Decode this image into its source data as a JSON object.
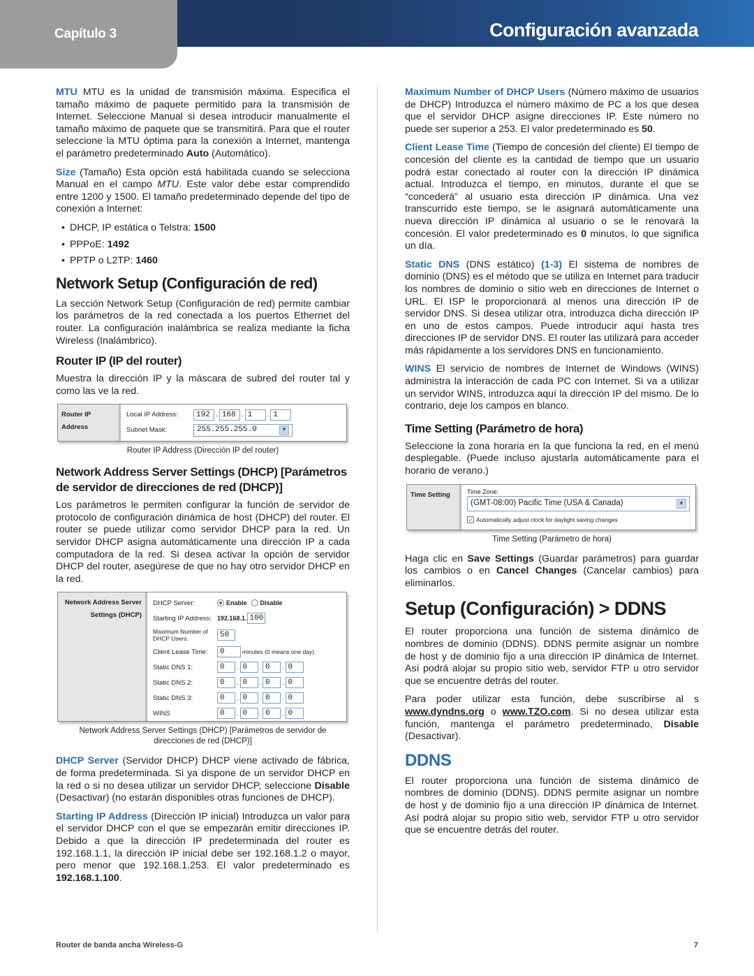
{
  "header": {
    "chapter": "Capítulo 3",
    "title": "Configuración avanzada"
  },
  "left": {
    "mtu": {
      "term": "MTU",
      "text": " MTU es la unidad de transmisión máxima. Especifica el tamaño máximo de paquete permitido para la transmisión de Internet. Seleccione Manual si desea introducir manualmente el tamaño máximo de paquete que se transmitirá. Para que el router seleccione la MTU óptima para la conexión a Internet, mantenga el parámetro predeterminado ",
      "bold": "Auto",
      "tail": " (Automático)."
    },
    "size": {
      "term": "Size",
      "text_a": " (Tamaño) Esta opción está habilitada cuando se selecciona Manual en el campo ",
      "italic": "MTU",
      "text_b": ". Este valor debe estar comprendido entre 1200 y 1500. El tamaño predeterminado depende del tipo de conexión a Internet:"
    },
    "bullets": [
      {
        "label": "DHCP, IP estática o Telstra: ",
        "value": "1500"
      },
      {
        "label": "PPPoE: ",
        "value": "1492"
      },
      {
        "label": "PPTP o L2TP: ",
        "value": "1460"
      }
    ],
    "network_setup": {
      "heading": "Network Setup (Configuración de red)",
      "text": "La sección Network Setup (Configuración de red) permite cambiar los parámetros de la red conectada a los puertos Ethernet del router. La configuración inalámbrica se realiza mediante la ficha Wireless (Inalámbrico)."
    },
    "router_ip": {
      "heading": "Router IP (IP del router)",
      "text": "Muestra la dirección IP y la máscara de subred del router tal y como las ve la red.",
      "figure": {
        "side_label": "Router IP Address",
        "local_ip_label": "Local IP Address:",
        "ip": [
          "192",
          "168",
          "1",
          "1"
        ],
        "subnet_label": "Subnet Mask:",
        "subnet_value": "255.255.255.0"
      },
      "caption": "Router IP Address (Dirección IP del router)"
    },
    "dhcp_section": {
      "heading": "Network Address Server Settings (DHCP) [Parámetros de servidor de direcciones de red (DHCP)]",
      "text": "Los parámetros le permiten configurar la función de servidor de protocolo de configuración dinámica de host (DHCP) del router. El router se puede utilizar como servidor DHCP para la red. Un servidor DHCP asigna automáticamente una dirección IP a cada computadora de la red. Si desea activar la opción de servidor DHCP del router, asegúrese de que no hay otro servidor DHCP en la red.",
      "figure": {
        "side_label": "Network Address Server Settings (DHCP)",
        "dhcp_server_label": "DHCP Server:",
        "enable": "Enable",
        "disable": "Disable",
        "starting_ip_label": "Starting IP Address:",
        "starting_ip_prefix": "192.168.1.",
        "starting_ip_value": "100",
        "max_users_label": "Maximum Number of DHCP Users:",
        "max_users_value": "50",
        "lease_label": "Client Lease Time:",
        "lease_value": "0",
        "lease_unit": "minutes (0 means one day)",
        "dns1_label": "Static DNS 1:",
        "dns2_label": "Static DNS 2:",
        "dns3_label": "Static DNS 3:",
        "wins_label": "WINS",
        "octet": "0"
      },
      "caption": "Network Address Server Settings (DHCP) [Parámetros de servidor de direcciones de red (DHCP)]"
    },
    "dhcp_server": {
      "term": "DHCP Server",
      "text_a": " (Servidor DHCP) DHCP viene activado de fábrica, de forma predeterminada. Si ya dispone de un servidor DHCP en la red o si no desea utilizar un servidor DHCP, seleccione ",
      "bold": "Disable",
      "text_b": " (Desactivar) (no estarán disponibles otras funciones de DHCP)."
    },
    "starting_ip": {
      "term": "Starting IP Address",
      "text": " (Dirección IP inicial) Introduzca un valor para el servidor DHCP con el que se empezarán emitir direcciones IP. Debido a que la dirección IP predeterminada del router es 192.168.1.1, la dirección IP inicial debe ser 192.168.1.2 o mayor, pero menor que 192.168.1.253. El valor predeterminado es ",
      "bold": "192.168.1.100",
      "tail": "."
    }
  },
  "right": {
    "max_users": {
      "term": "Maximum Number of DHCP Users",
      "text": " (Número máximo de usuarios de DHCP) Introduzca el número máximo de PC a los que desea que el servidor DHCP asigne direcciones IP. Este número no puede ser superior a 253. El valor predeterminado es ",
      "bold": "50",
      "tail": "."
    },
    "lease": {
      "term": "Client Lease Time",
      "text": " (Tiempo de concesión del cliente) El tiempo de concesión del cliente es la cantidad de tiempo que un usuario podrá estar conectado al router con la dirección IP dinámica actual. Introduzca el tiempo, en minutos, durante el que se “concederá” al usuario esta dirección IP dinámica. Una vez transcurrido este tiempo, se le asignará automáticamente una nueva dirección IP dinámica al usuario o se le renovará la concesión. El valor predeterminado es ",
      "bold": "0",
      "tail": " minutos, lo que significa un día."
    },
    "static_dns": {
      "term": "Static DNS",
      "text_a": " (DNS estático) ",
      "range": "(1-3)",
      "text_b": " El sistema de nombres de dominio (DNS) es el método que se utiliza en Internet para traducir los nombres de dominio o sitio web en direcciones de Internet o URL. El ISP le proporcionará al menos una dirección IP de servidor DNS. Si desea utilizar otra, introduzca dicha dirección IP en uno de estos campos. Puede introducir aquí hasta tres direcciones IP de servidor DNS. El router las utilizará para acceder más rápidamente a los servidores DNS en funcionamiento."
    },
    "wins": {
      "term": "WINS",
      "text": " El servicio de nombres de Internet de Windows (WINS) administra la interacción de cada PC con Internet. Si va a utilizar un servidor WINS, introduzca aquí la dirección IP del mismo. De lo contrario, deje los campos en blanco."
    },
    "time_setting": {
      "heading": "Time Setting (Parámetro de hora)",
      "text": "Seleccione la zona horaria en la que funciona la red, en el menú desplegable. (Puede incluso ajustarla automáticamente para el horario de verano.)",
      "figure": {
        "side_label": "Time Setting",
        "zone_label": "Time Zone:",
        "zone_value": "(GMT-08:00) Pacific Time (USA & Canada)",
        "auto_label": "Automatically adjust clock for daylight saving changes",
        "auto_checked": true
      },
      "caption": "Time Setting (Parámetro de hora)"
    },
    "save": {
      "text_a": "Haga clic en ",
      "save_label": "Save Settings",
      "text_b": " (Guardar parámetros) para guardar los cambios o en ",
      "cancel_label": "Cancel Changes",
      "text_c": " (Cancelar cambios) para eliminarlos."
    },
    "ddns_setup": {
      "heading": "Setup (Configuración) > DDNS",
      "text1": "El router proporciona una función de sistema dinámico de nombres de dominio (DDNS). DDNS permite asignar un nombre de host y de dominio fijo a una dirección IP dinámica de Internet. Así podrá alojar su propio sitio web, servidor FTP u otro servidor que se encuentre detrás del router.",
      "text2_a": "Para poder utilizar esta función, debe suscribirse al s ",
      "link1": "www.dyndns.org",
      "text2_b": " o ",
      "link2": "www.TZO.com",
      "text2_c": ". Si no desea utilizar esta función, mantenga el parámetro predeterminado, ",
      "bold": "Disable",
      "text2_d": " (Desactivar)."
    },
    "ddns": {
      "heading": "DDNS",
      "text": "El router proporciona una función de sistema dinámico de nombres de dominio (DDNS). DDNS permite asignar un nombre de host y de dominio fijo a una dirección IP dinámica de Internet. Así podrá alojar su propio sitio web, servidor FTP u otro servidor que se encuentre detrás del router."
    }
  },
  "footer": {
    "product": "Router de banda ancha Wireless-G",
    "page": "7"
  }
}
